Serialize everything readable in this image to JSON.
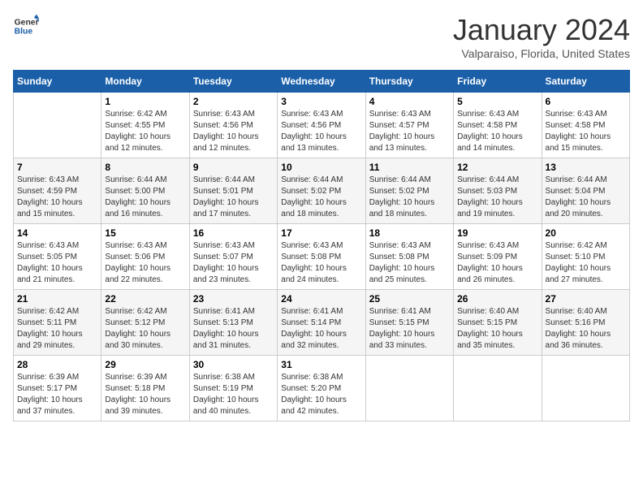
{
  "header": {
    "logo_line1": "General",
    "logo_line2": "Blue",
    "month": "January 2024",
    "location": "Valparaiso, Florida, United States"
  },
  "weekdays": [
    "Sunday",
    "Monday",
    "Tuesday",
    "Wednesday",
    "Thursday",
    "Friday",
    "Saturday"
  ],
  "weeks": [
    [
      {
        "day": "",
        "sunrise": "",
        "sunset": "",
        "daylight": ""
      },
      {
        "day": "1",
        "sunrise": "Sunrise: 6:42 AM",
        "sunset": "Sunset: 4:55 PM",
        "daylight": "Daylight: 10 hours and 12 minutes."
      },
      {
        "day": "2",
        "sunrise": "Sunrise: 6:43 AM",
        "sunset": "Sunset: 4:56 PM",
        "daylight": "Daylight: 10 hours and 12 minutes."
      },
      {
        "day": "3",
        "sunrise": "Sunrise: 6:43 AM",
        "sunset": "Sunset: 4:56 PM",
        "daylight": "Daylight: 10 hours and 13 minutes."
      },
      {
        "day": "4",
        "sunrise": "Sunrise: 6:43 AM",
        "sunset": "Sunset: 4:57 PM",
        "daylight": "Daylight: 10 hours and 13 minutes."
      },
      {
        "day": "5",
        "sunrise": "Sunrise: 6:43 AM",
        "sunset": "Sunset: 4:58 PM",
        "daylight": "Daylight: 10 hours and 14 minutes."
      },
      {
        "day": "6",
        "sunrise": "Sunrise: 6:43 AM",
        "sunset": "Sunset: 4:58 PM",
        "daylight": "Daylight: 10 hours and 15 minutes."
      }
    ],
    [
      {
        "day": "7",
        "sunrise": "Sunrise: 6:43 AM",
        "sunset": "Sunset: 4:59 PM",
        "daylight": "Daylight: 10 hours and 15 minutes."
      },
      {
        "day": "8",
        "sunrise": "Sunrise: 6:44 AM",
        "sunset": "Sunset: 5:00 PM",
        "daylight": "Daylight: 10 hours and 16 minutes."
      },
      {
        "day": "9",
        "sunrise": "Sunrise: 6:44 AM",
        "sunset": "Sunset: 5:01 PM",
        "daylight": "Daylight: 10 hours and 17 minutes."
      },
      {
        "day": "10",
        "sunrise": "Sunrise: 6:44 AM",
        "sunset": "Sunset: 5:02 PM",
        "daylight": "Daylight: 10 hours and 18 minutes."
      },
      {
        "day": "11",
        "sunrise": "Sunrise: 6:44 AM",
        "sunset": "Sunset: 5:02 PM",
        "daylight": "Daylight: 10 hours and 18 minutes."
      },
      {
        "day": "12",
        "sunrise": "Sunrise: 6:44 AM",
        "sunset": "Sunset: 5:03 PM",
        "daylight": "Daylight: 10 hours and 19 minutes."
      },
      {
        "day": "13",
        "sunrise": "Sunrise: 6:44 AM",
        "sunset": "Sunset: 5:04 PM",
        "daylight": "Daylight: 10 hours and 20 minutes."
      }
    ],
    [
      {
        "day": "14",
        "sunrise": "Sunrise: 6:43 AM",
        "sunset": "Sunset: 5:05 PM",
        "daylight": "Daylight: 10 hours and 21 minutes."
      },
      {
        "day": "15",
        "sunrise": "Sunrise: 6:43 AM",
        "sunset": "Sunset: 5:06 PM",
        "daylight": "Daylight: 10 hours and 22 minutes."
      },
      {
        "day": "16",
        "sunrise": "Sunrise: 6:43 AM",
        "sunset": "Sunset: 5:07 PM",
        "daylight": "Daylight: 10 hours and 23 minutes."
      },
      {
        "day": "17",
        "sunrise": "Sunrise: 6:43 AM",
        "sunset": "Sunset: 5:08 PM",
        "daylight": "Daylight: 10 hours and 24 minutes."
      },
      {
        "day": "18",
        "sunrise": "Sunrise: 6:43 AM",
        "sunset": "Sunset: 5:08 PM",
        "daylight": "Daylight: 10 hours and 25 minutes."
      },
      {
        "day": "19",
        "sunrise": "Sunrise: 6:43 AM",
        "sunset": "Sunset: 5:09 PM",
        "daylight": "Daylight: 10 hours and 26 minutes."
      },
      {
        "day": "20",
        "sunrise": "Sunrise: 6:42 AM",
        "sunset": "Sunset: 5:10 PM",
        "daylight": "Daylight: 10 hours and 27 minutes."
      }
    ],
    [
      {
        "day": "21",
        "sunrise": "Sunrise: 6:42 AM",
        "sunset": "Sunset: 5:11 PM",
        "daylight": "Daylight: 10 hours and 29 minutes."
      },
      {
        "day": "22",
        "sunrise": "Sunrise: 6:42 AM",
        "sunset": "Sunset: 5:12 PM",
        "daylight": "Daylight: 10 hours and 30 minutes."
      },
      {
        "day": "23",
        "sunrise": "Sunrise: 6:41 AM",
        "sunset": "Sunset: 5:13 PM",
        "daylight": "Daylight: 10 hours and 31 minutes."
      },
      {
        "day": "24",
        "sunrise": "Sunrise: 6:41 AM",
        "sunset": "Sunset: 5:14 PM",
        "daylight": "Daylight: 10 hours and 32 minutes."
      },
      {
        "day": "25",
        "sunrise": "Sunrise: 6:41 AM",
        "sunset": "Sunset: 5:15 PM",
        "daylight": "Daylight: 10 hours and 33 minutes."
      },
      {
        "day": "26",
        "sunrise": "Sunrise: 6:40 AM",
        "sunset": "Sunset: 5:15 PM",
        "daylight": "Daylight: 10 hours and 35 minutes."
      },
      {
        "day": "27",
        "sunrise": "Sunrise: 6:40 AM",
        "sunset": "Sunset: 5:16 PM",
        "daylight": "Daylight: 10 hours and 36 minutes."
      }
    ],
    [
      {
        "day": "28",
        "sunrise": "Sunrise: 6:39 AM",
        "sunset": "Sunset: 5:17 PM",
        "daylight": "Daylight: 10 hours and 37 minutes."
      },
      {
        "day": "29",
        "sunrise": "Sunrise: 6:39 AM",
        "sunset": "Sunset: 5:18 PM",
        "daylight": "Daylight: 10 hours and 39 minutes."
      },
      {
        "day": "30",
        "sunrise": "Sunrise: 6:38 AM",
        "sunset": "Sunset: 5:19 PM",
        "daylight": "Daylight: 10 hours and 40 minutes."
      },
      {
        "day": "31",
        "sunrise": "Sunrise: 6:38 AM",
        "sunset": "Sunset: 5:20 PM",
        "daylight": "Daylight: 10 hours and 42 minutes."
      },
      {
        "day": "",
        "sunrise": "",
        "sunset": "",
        "daylight": ""
      },
      {
        "day": "",
        "sunrise": "",
        "sunset": "",
        "daylight": ""
      },
      {
        "day": "",
        "sunrise": "",
        "sunset": "",
        "daylight": ""
      }
    ]
  ]
}
